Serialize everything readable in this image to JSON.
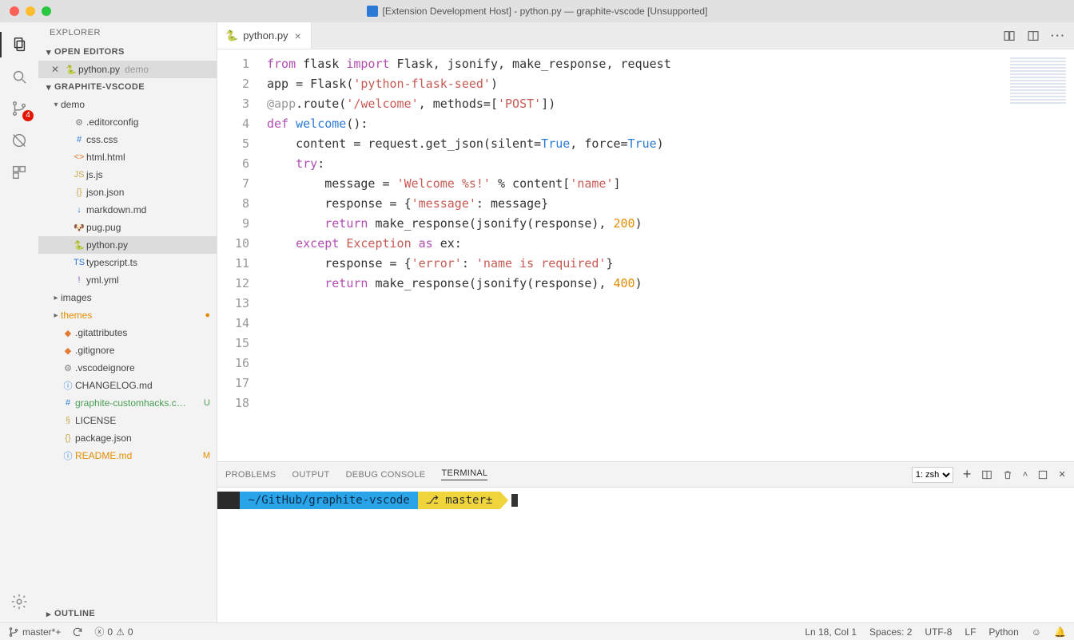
{
  "window": {
    "title": "[Extension Development Host] - python.py — graphite-vscode [Unsupported]"
  },
  "activitybar": {
    "scm_badge": "4"
  },
  "explorer": {
    "title": "EXPLORER",
    "open_editors_label": "OPEN EDITORS",
    "open_editors": [
      {
        "label": "python.py",
        "meta": "demo"
      }
    ],
    "workspace_label": "GRAPHITE-VSCODE",
    "tree": [
      {
        "type": "folder",
        "label": "demo",
        "expanded": true,
        "indent": 0
      },
      {
        "type": "file",
        "label": ".editorconfig",
        "icon": "cfg",
        "indent": 1
      },
      {
        "type": "file",
        "label": "css.css",
        "icon": "css",
        "indent": 1
      },
      {
        "type": "file",
        "label": "html.html",
        "icon": "html",
        "indent": 1
      },
      {
        "type": "file",
        "label": "js.js",
        "icon": "js",
        "indent": 1
      },
      {
        "type": "file",
        "label": "json.json",
        "icon": "json",
        "indent": 1
      },
      {
        "type": "file",
        "label": "markdown.md",
        "icon": "md",
        "indent": 1
      },
      {
        "type": "file",
        "label": "pug.pug",
        "icon": "pug",
        "indent": 1
      },
      {
        "type": "file",
        "label": "python.py",
        "icon": "py",
        "indent": 1,
        "selected": true
      },
      {
        "type": "file",
        "label": "typescript.ts",
        "icon": "ts",
        "indent": 1
      },
      {
        "type": "file",
        "label": "yml.yml",
        "icon": "yml",
        "indent": 1
      },
      {
        "type": "folder",
        "label": "images",
        "expanded": false,
        "indent": 0
      },
      {
        "type": "folder",
        "label": "themes",
        "expanded": false,
        "indent": 0,
        "status": "modified",
        "decoration": "●"
      },
      {
        "type": "file",
        "label": ".gitattributes",
        "icon": "git",
        "indent": 0
      },
      {
        "type": "file",
        "label": ".gitignore",
        "icon": "git",
        "indent": 0
      },
      {
        "type": "file",
        "label": ".vscodeignore",
        "icon": "cfg",
        "indent": 0
      },
      {
        "type": "file",
        "label": "CHANGELOG.md",
        "icon": "info",
        "indent": 0
      },
      {
        "type": "file",
        "label": "graphite-customhacks.c…",
        "icon": "css",
        "indent": 0,
        "status": "new",
        "decoration": "U"
      },
      {
        "type": "file",
        "label": "LICENSE",
        "icon": "lic",
        "indent": 0
      },
      {
        "type": "file",
        "label": "package.json",
        "icon": "pkg",
        "indent": 0
      },
      {
        "type": "file",
        "label": "README.md",
        "icon": "info",
        "indent": 0,
        "status": "modified",
        "decoration": "M"
      }
    ],
    "outline_label": "OUTLINE"
  },
  "tabs": [
    {
      "label": "python.py",
      "icon": "py",
      "active": true
    }
  ],
  "code": {
    "line_start": 1,
    "line_end": 18,
    "lines": [
      [
        [
          "kw",
          "from"
        ],
        [
          "",
          " flask "
        ],
        [
          "kw",
          "import"
        ],
        [
          "",
          " Flask, jsonify, make_response, request"
        ]
      ],
      [
        [
          "",
          ""
        ]
      ],
      [
        [
          "",
          "app = Flask("
        ],
        [
          "str",
          "'python-flask-seed'"
        ],
        [
          "",
          ")"
        ]
      ],
      [
        [
          "",
          ""
        ]
      ],
      [
        [
          "",
          ""
        ]
      ],
      [
        [
          "decor",
          "@app"
        ],
        [
          "",
          ".route("
        ],
        [
          "str",
          "'/welcome'"
        ],
        [
          "",
          ", methods=["
        ],
        [
          "str",
          "'POST'"
        ],
        [
          "",
          "])"
        ]
      ],
      [
        [
          "kw",
          "def"
        ],
        [
          "",
          " "
        ],
        [
          "name",
          "welcome"
        ],
        [
          "",
          "():"
        ]
      ],
      [
        [
          "",
          "    content = request.get_json(silent="
        ],
        [
          "const",
          "True"
        ],
        [
          "",
          ", force="
        ],
        [
          "const",
          "True"
        ],
        [
          "",
          ")"
        ]
      ],
      [
        [
          "",
          ""
        ]
      ],
      [
        [
          "",
          "    "
        ],
        [
          "kw",
          "try"
        ],
        [
          "",
          ":"
        ]
      ],
      [
        [
          "",
          "        message = "
        ],
        [
          "str",
          "'Welcome %s!'"
        ],
        [
          "",
          " % content["
        ],
        [
          "str",
          "'name'"
        ],
        [
          "",
          "]"
        ]
      ],
      [
        [
          "",
          "        response = {"
        ],
        [
          "str",
          "'message'"
        ],
        [
          "",
          ": message}"
        ]
      ],
      [
        [
          "",
          "        "
        ],
        [
          "kw",
          "return"
        ],
        [
          "",
          " make_response(jsonify(response), "
        ],
        [
          "num",
          "200"
        ],
        [
          "",
          ")"
        ]
      ],
      [
        [
          "",
          ""
        ]
      ],
      [
        [
          "",
          "    "
        ],
        [
          "kw",
          "except"
        ],
        [
          "",
          " "
        ],
        [
          "err",
          "Exception"
        ],
        [
          "",
          " "
        ],
        [
          "kw",
          "as"
        ],
        [
          "",
          " ex:"
        ]
      ],
      [
        [
          "",
          "        response = {"
        ],
        [
          "str",
          "'error'"
        ],
        [
          "",
          ": "
        ],
        [
          "str",
          "'name is required'"
        ],
        [
          "",
          "}"
        ]
      ],
      [
        [
          "",
          "        "
        ],
        [
          "kw",
          "return"
        ],
        [
          "",
          " make_response(jsonify(response), "
        ],
        [
          "num",
          "400"
        ],
        [
          "",
          ")"
        ]
      ],
      [
        [
          "",
          ""
        ]
      ]
    ],
    "current_line": 18
  },
  "panel": {
    "tabs": {
      "problems": "PROBLEMS",
      "output": "OUTPUT",
      "debug": "DEBUG CONSOLE",
      "terminal": "TERMINAL"
    },
    "active": "terminal",
    "terminal_select": "1: zsh",
    "prompt_path": "~/GitHub/graphite-vscode",
    "prompt_branch": "master±"
  },
  "statusbar": {
    "branch": "master*+",
    "errors": "0",
    "warnings": "0",
    "lncol": "Ln 18, Col 1",
    "spaces": "Spaces: 2",
    "encoding": "UTF-8",
    "eol": "LF",
    "language": "Python"
  }
}
